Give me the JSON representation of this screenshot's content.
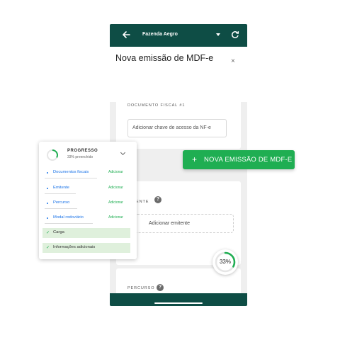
{
  "phone": {
    "app_title": "Fazenda Aegro",
    "heading": "Nova emissão de MDF-e",
    "close_label": "×",
    "doc_card": {
      "label": "DOCUMENTO FISCAL #1",
      "access_key_placeholder": "Adicionar chave de acesso da NF-e"
    },
    "emitter_card": {
      "label": "ENTE",
      "help": "?",
      "add_label": "Adicionar emitente"
    },
    "route_card": {
      "label": "PERCURSO",
      "help": "?"
    },
    "progress_gauge": {
      "label": "33%",
      "fraction": 0.33
    }
  },
  "fab": {
    "plus": "+",
    "label": "NOVA EMISSÃO DE MDF-E"
  },
  "progress_panel": {
    "title": "PROGRESSO",
    "subtitle": "33% preenchido",
    "fraction": 0.33,
    "items": [
      {
        "label": "Documentos fiscais",
        "action": "Adicionar",
        "done": false
      },
      {
        "label": "Emitente",
        "action": "Adicionar",
        "done": false
      },
      {
        "label": "Percurso",
        "action": "Adicionar",
        "done": false
      },
      {
        "label": "Modal rodoviário",
        "action": "Adicionar",
        "done": false
      },
      {
        "label": "Carga",
        "action": "",
        "done": true
      },
      {
        "label": "Informações adicionais",
        "action": "",
        "done": true
      }
    ]
  },
  "colors": {
    "app_bar": "#0e4d45",
    "accent_green": "#1fae52",
    "link_blue": "#1a73e8",
    "done_row": "#dff0dc"
  },
  "icons": [
    "back-arrow-icon",
    "dropdown-caret-icon",
    "refresh-icon",
    "close-icon",
    "help-icon",
    "plus-icon",
    "check-icon",
    "chevron-down-icon",
    "progress-ring-icon"
  ]
}
